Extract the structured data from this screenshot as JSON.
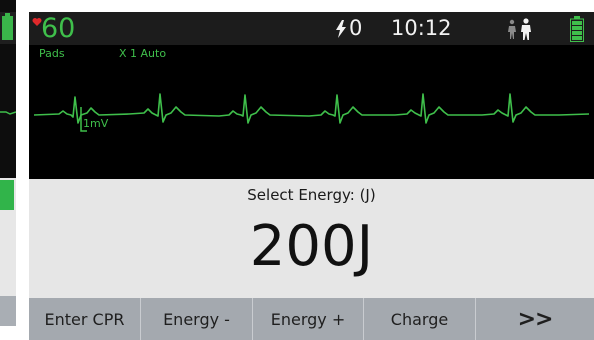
{
  "header": {
    "heart_rate": "60",
    "shock_count": "0",
    "time": "10:12"
  },
  "ecg": {
    "lead": "Pads",
    "gain": "X 1 Auto",
    "scale": "1mV",
    "trace_color": "#3fbf4b"
  },
  "energy": {
    "title": "Select Energy: (J)",
    "value": "200J"
  },
  "softkeys": [
    {
      "label": "Enter CPR"
    },
    {
      "label": "Energy -"
    },
    {
      "label": "Energy +"
    },
    {
      "label": "Charge"
    },
    {
      "label": ">>"
    }
  ],
  "colors": {
    "accent_green": "#3fbf4b",
    "heart_red": "#e0292b",
    "softkey_bar": "#a4a9af"
  }
}
